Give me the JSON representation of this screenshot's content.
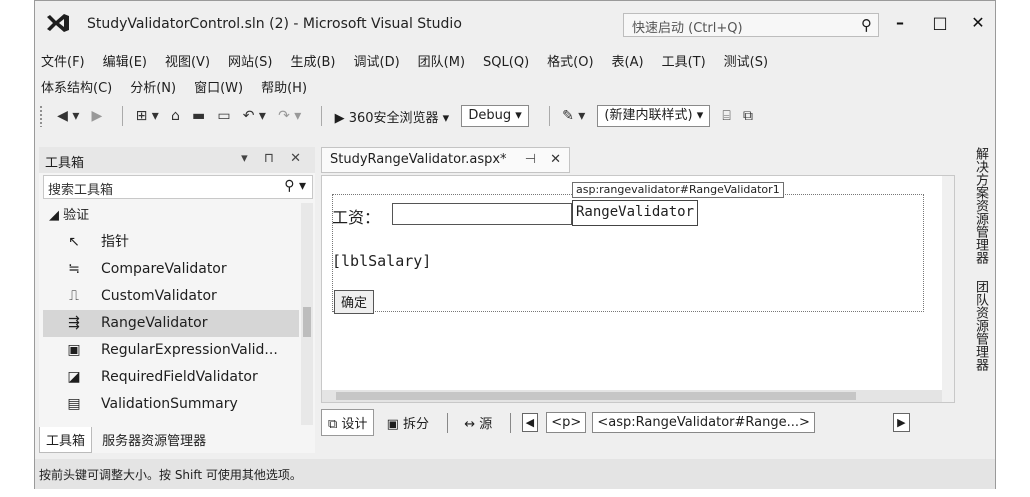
{
  "window": {
    "title": "StudyValidatorControl.sln (2) - Microsoft Visual Studio",
    "quick_launch_placeholder": "快速启动 (Ctrl+Q)",
    "controls": {
      "minimize": "–",
      "maximize": "□",
      "close": "✕"
    }
  },
  "menu": {
    "row1": [
      "文件(F)",
      "编辑(E)",
      "视图(V)",
      "网站(S)",
      "生成(B)",
      "调试(D)",
      "团队(M)",
      "SQL(Q)",
      "格式(O)",
      "表(A)",
      "工具(T)",
      "测试(S)"
    ],
    "row2": [
      "体系结构(C)",
      "分析(N)",
      "窗口(W)",
      "帮助(H)"
    ]
  },
  "toolbar": {
    "run_label": "▶ 360安全浏览器 ▾",
    "config_value": "Debug",
    "style_value": "(新建内联样式)"
  },
  "toolbox": {
    "title": "工具箱",
    "header_controls": "▾ ⊓ ✕",
    "search_placeholder": "搜索工具箱",
    "group": "◢ 验证",
    "items": [
      {
        "icon": "pointer-icon",
        "glyph": "↖",
        "label": "指针"
      },
      {
        "icon": "compare-validator-icon",
        "glyph": "≒",
        "label": "CompareValidator"
      },
      {
        "icon": "custom-validator-icon",
        "glyph": "⎍",
        "label": "CustomValidator"
      },
      {
        "icon": "range-validator-icon",
        "glyph": "⇶",
        "label": "RangeValidator",
        "selected": true
      },
      {
        "icon": "regex-validator-icon",
        "glyph": "▣",
        "label": "RegularExpressionValid..."
      },
      {
        "icon": "required-validator-icon",
        "glyph": "◪",
        "label": "RequiredFieldValidator"
      },
      {
        "icon": "validation-summary-icon",
        "glyph": "▤",
        "label": "ValidationSummary"
      }
    ],
    "tabs": [
      "工具箱",
      "服务器资源管理器"
    ]
  },
  "editor": {
    "tab_label": "StudyRangeValidator.aspx*",
    "tab_pin": "⊣",
    "tab_close": "✕",
    "salary_label": "工资：",
    "smart_tag": "asp:rangevalidator#RangeValidator1",
    "range_validator_text": "RangeValidator",
    "lbl_salary": "[lblSalary]",
    "ok_button": "确定",
    "views": {
      "design": "⧉ 设计",
      "split": "▣ 拆分",
      "source": "↔ 源"
    },
    "breadcrumbs": [
      "<p>",
      "<asp:RangeValidator#Range...>"
    ]
  },
  "side_panel": [
    "解决方案资源管理器",
    "团队资源管理器"
  ],
  "status": "按前头键可调整大小。按 Shift 可使用其他选项。"
}
